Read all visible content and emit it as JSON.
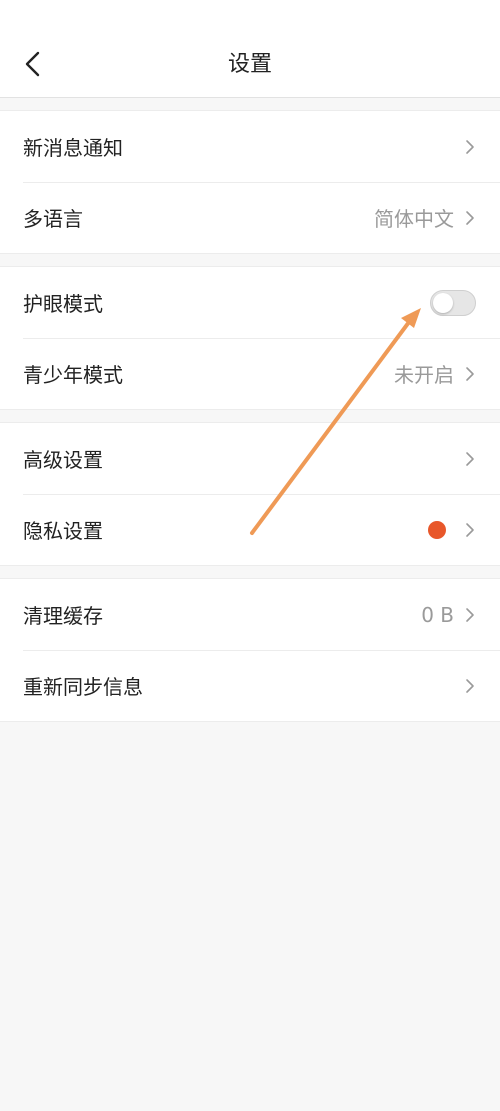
{
  "header": {
    "title": "设置",
    "back_icon": "chevron-left-icon"
  },
  "groups": [
    {
      "rows": [
        {
          "label": "新消息通知",
          "value": "",
          "trailing": "chevron"
        },
        {
          "label": "多语言",
          "value": "简体中文",
          "trailing": "chevron"
        }
      ]
    },
    {
      "rows": [
        {
          "label": "护眼模式",
          "value": "",
          "trailing": "toggle",
          "toggle_on": false
        },
        {
          "label": "青少年模式",
          "value": "未开启",
          "trailing": "chevron"
        }
      ]
    },
    {
      "rows": [
        {
          "label": "高级设置",
          "value": "",
          "trailing": "chevron"
        },
        {
          "label": "隐私设置",
          "value": "",
          "trailing": "chevron",
          "badge": "red-dot"
        }
      ]
    },
    {
      "rows": [
        {
          "label": "清理缓存",
          "value": "0 B",
          "trailing": "chevron"
        },
        {
          "label": "重新同步信息",
          "value": "",
          "trailing": "chevron"
        }
      ]
    }
  ],
  "colors": {
    "badge_dot": "#e8572a",
    "annotation_arrow": "#ef9a56",
    "chevron": "#9a9a9a"
  }
}
